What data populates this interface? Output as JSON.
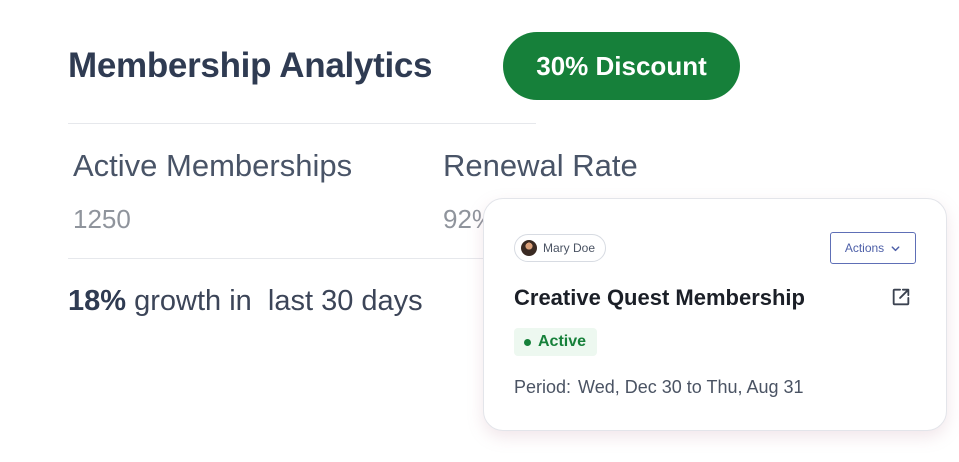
{
  "header": {
    "title": "Membership Analytics",
    "discount_label": "30% Discount"
  },
  "stats": [
    {
      "label": "Active Memberships",
      "value": "1250"
    },
    {
      "label": "Renewal Rate",
      "value": "92%"
    }
  ],
  "growth": {
    "value": "18%",
    "text": " growth in  last 30 days"
  },
  "card": {
    "owner_name": "Mary Doe",
    "actions_label": "Actions",
    "title": "Creative Quest Membership",
    "status": "Active",
    "period_label": "Period:",
    "period_value": "Wed, Dec 30 to Thu, Aug 31"
  },
  "colors": {
    "brand_green": "#16803a",
    "heading": "#2f3b52",
    "actions_blue": "#4d5fa8"
  },
  "icons": {
    "actions": "chevron-down-icon",
    "card_link": "external-link-icon",
    "status": "status-dot-icon"
  }
}
